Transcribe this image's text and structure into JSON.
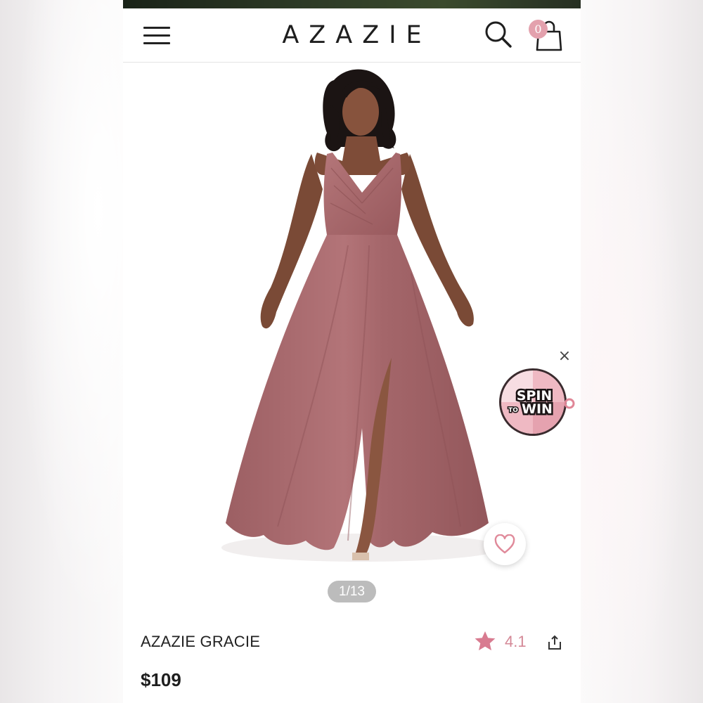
{
  "header": {
    "brand": "AZAZIE",
    "cart_count": "0",
    "icons": [
      "hamburger-menu-icon",
      "search-icon",
      "shopping-bag-icon"
    ]
  },
  "gallery": {
    "counter": "1/13",
    "image_alt": "Model wearing a long dusty rose chiffon dress with V-neck and front slit"
  },
  "promo": {
    "spin_line1": "SPIN",
    "spin_to": "TO",
    "spin_line2": "WIN",
    "close_symbol": "×"
  },
  "product": {
    "name": "AZAZIE GRACIE",
    "price": "$109",
    "rating": "4.1"
  },
  "colors": {
    "accent_pink": "#e3a1ad",
    "rating_pink": "#d48896",
    "dress": "#a96a6d"
  }
}
